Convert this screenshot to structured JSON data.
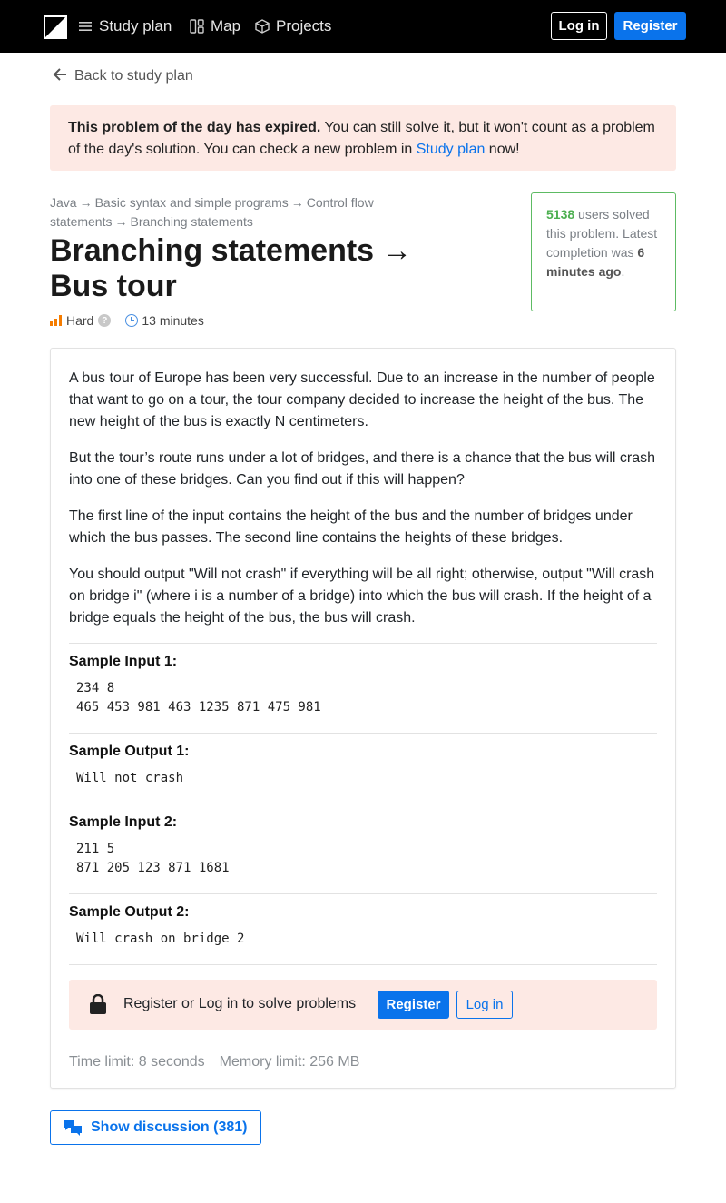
{
  "nav": {
    "items": [
      {
        "label": "Study plan",
        "icon": "menu-icon"
      },
      {
        "label": "Map",
        "icon": "map-icon"
      },
      {
        "label": "Projects",
        "icon": "cube-icon"
      }
    ],
    "login_label": "Log in",
    "register_label": "Register"
  },
  "back_label": "Back to study plan",
  "expired": {
    "bold": "This problem of the day has expired.",
    "text": " You can still solve it, but it won't count as a problem of the day's solution. You can check a new problem in ",
    "link": "Study plan",
    "tail": " now!"
  },
  "breadcrumbs": [
    "Java",
    "Basic syntax and simple programs",
    "Control flow statements",
    "Branching statements"
  ],
  "title": {
    "topic": "Branching statements",
    "arrow": "→",
    "problem": "Bus tour"
  },
  "meta": {
    "difficulty": "Hard",
    "help": "?",
    "time": "13 minutes"
  },
  "solved": {
    "count": "5138",
    "text": " users solved this problem. Latest completion was ",
    "ago": "6 minutes ago",
    "end": "."
  },
  "problem": {
    "paragraphs": [
      "A bus tour of Europe has been very successful. Due to an increase in the number of people that want to go on a tour, the tour company decided to increase the height of the bus. The new height of the bus is exactly N centimeters.",
      "But the tour’s route runs under a lot of bridges, and there is a chance that the bus will crash into one of these bridges. Can you find out if this will happen?",
      "The first line of the input contains the height of the bus and the number of bridges under which the bus passes. The second line contains the heights of these bridges.",
      "You should output \"Will not crash\" if everything will be all right; otherwise, output \"Will crash on bridge i\" (where i is a number of a bridge) into which the bus will crash. If the height of a bridge equals the height of the bus, the bus will crash."
    ],
    "samples": [
      {
        "label": "Sample Input 1:",
        "code": "234 8\n465 453 981 463 1235 871 475 981"
      },
      {
        "label": "Sample Output 1:",
        "code": "Will not crash"
      },
      {
        "label": "Sample Input 2:",
        "code": "211 5\n871 205 123 871 1681"
      },
      {
        "label": "Sample Output 2:",
        "code": "Will crash on bridge 2"
      }
    ]
  },
  "auth": {
    "text": "Register or Log in to solve problems",
    "register_label": "Register",
    "login_label": "Log in"
  },
  "limits": {
    "time": "Time limit: 8 seconds",
    "memory": "Memory limit: 256 MB"
  },
  "discussion_label": "Show discussion (381)",
  "colors": {
    "accent": "#0a73eb",
    "banner_bg": "#fde9e4",
    "success": "#4caf50",
    "difficulty": "#f57c00"
  }
}
